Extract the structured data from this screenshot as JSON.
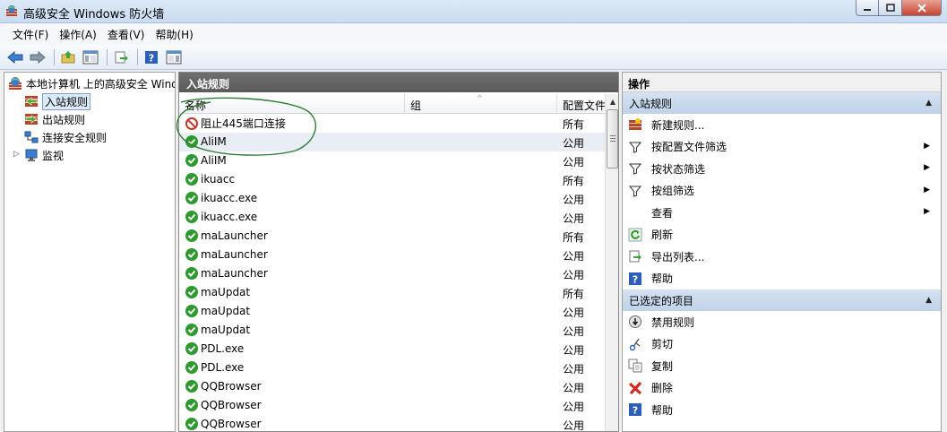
{
  "window": {
    "title": "高级安全 Windows 防火墙"
  },
  "menu": [
    "文件(F)",
    "操作(A)",
    "查看(V)",
    "帮助(H)"
  ],
  "tree": {
    "root": "本地计算机 上的高级安全 Windows 防火墙",
    "items": [
      "入站规则",
      "出站规则",
      "连接安全规则",
      "监视"
    ]
  },
  "center": {
    "header": "入站规则",
    "columns": {
      "name": "名称",
      "group": "组",
      "profile": "配置文件"
    },
    "rows": [
      {
        "name": "阻止445端口连接",
        "profile": "所有",
        "status": "blocked"
      },
      {
        "name": "AliIM",
        "profile": "公用",
        "status": "allowed"
      },
      {
        "name": "AliIM",
        "profile": "公用",
        "status": "allowed"
      },
      {
        "name": "ikuacc",
        "profile": "所有",
        "status": "allowed"
      },
      {
        "name": "ikuacc.exe",
        "profile": "公用",
        "status": "allowed"
      },
      {
        "name": "ikuacc.exe",
        "profile": "公用",
        "status": "allowed"
      },
      {
        "name": "maLauncher",
        "profile": "所有",
        "status": "allowed"
      },
      {
        "name": "maLauncher",
        "profile": "公用",
        "status": "allowed"
      },
      {
        "name": "maLauncher",
        "profile": "公用",
        "status": "allowed"
      },
      {
        "name": "maUpdat",
        "profile": "所有",
        "status": "allowed"
      },
      {
        "name": "maUpdat",
        "profile": "公用",
        "status": "allowed"
      },
      {
        "name": "maUpdat",
        "profile": "公用",
        "status": "allowed"
      },
      {
        "name": "PDL.exe",
        "profile": "公用",
        "status": "allowed"
      },
      {
        "name": "PDL.exe",
        "profile": "公用",
        "status": "allowed"
      },
      {
        "name": "QQBrowser",
        "profile": "公用",
        "status": "allowed"
      },
      {
        "name": "QQBrowser",
        "profile": "公用",
        "status": "allowed"
      },
      {
        "name": "QQBrowser",
        "profile": "公用",
        "status": "allowed"
      }
    ]
  },
  "actions": {
    "title": "操作",
    "section1": {
      "label": "入站规则",
      "items": [
        {
          "label": "新建规则...",
          "icon": "new-rule-icon",
          "submenu": false
        },
        {
          "label": "按配置文件筛选",
          "icon": "filter-icon",
          "submenu": true
        },
        {
          "label": "按状态筛选",
          "icon": "filter-icon",
          "submenu": true
        },
        {
          "label": "按组筛选",
          "icon": "filter-icon",
          "submenu": true
        },
        {
          "label": "查看",
          "icon": "",
          "submenu": true
        },
        {
          "label": "刷新",
          "icon": "refresh-icon",
          "submenu": false
        },
        {
          "label": "导出列表...",
          "icon": "export-icon",
          "submenu": false
        },
        {
          "label": "帮助",
          "icon": "help-icon",
          "submenu": false
        }
      ]
    },
    "section2": {
      "label": "已选定的项目",
      "items": [
        {
          "label": "禁用规则",
          "icon": "disable-icon",
          "submenu": false
        },
        {
          "label": "剪切",
          "icon": "cut-icon",
          "submenu": false
        },
        {
          "label": "复制",
          "icon": "copy-icon",
          "submenu": false
        },
        {
          "label": "删除",
          "icon": "delete-icon",
          "submenu": false
        },
        {
          "label": "帮助",
          "icon": "help-icon",
          "submenu": false
        }
      ]
    }
  },
  "colors": {
    "allowed": "#2e9a2e",
    "blocked": "#c0392b",
    "section_bg": "#c9d9ed",
    "annotation": "#2e7d32"
  }
}
